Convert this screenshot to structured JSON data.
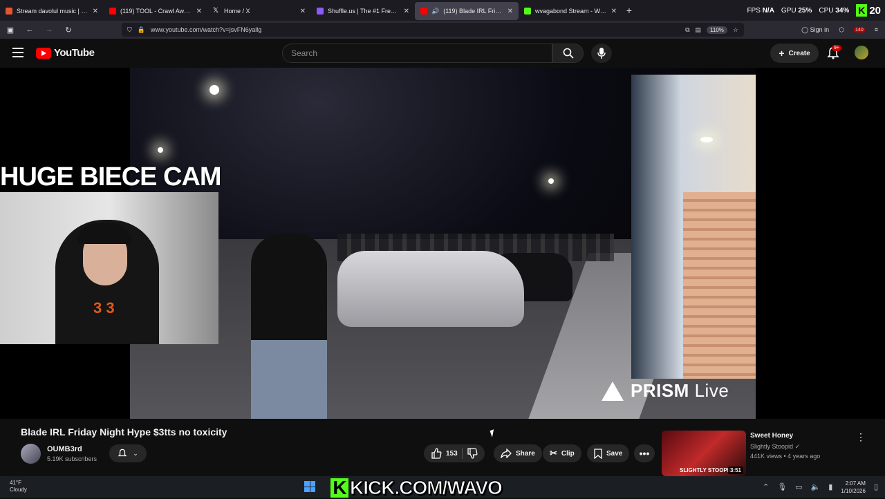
{
  "browser": {
    "tabs": [
      {
        "title": "Stream davolul music | Listen to",
        "color": "#e8542f"
      },
      {
        "title": "(119) TOOL - Crawl Away (Audio",
        "color": "#ff0000"
      },
      {
        "title": "Home / X",
        "color": "#ffffff"
      },
      {
        "title": "Shuffle.us | The #1 Free to Play",
        "color": "#8a5cf6"
      },
      {
        "title": "(119) Blade IRL Friday Night",
        "color": "#ff0000"
      },
      {
        "title": "wvagabond Stream - Watch Live",
        "color": "#53fc18"
      }
    ],
    "stats": {
      "fps_label": "FPS",
      "fps_value": "N/A",
      "gpu_label": "GPU",
      "gpu_value": "25%",
      "cpu_label": "CPU",
      "cpu_value": "34%",
      "kick_count": "20"
    },
    "url": "www.youtube.com/watch?v=jsvFN6yallg",
    "zoom": "110%",
    "sign_in": "Sign in",
    "ext_badge": "140"
  },
  "youtube": {
    "logo_text": "YouTube",
    "search_placeholder": "Search",
    "create_label": "Create",
    "notif_count": "9+"
  },
  "video": {
    "overlay_label": "HUGE BIECE CAM",
    "watermark": "PRISM",
    "watermark_light": "Live",
    "webcam_logo": "3 3"
  },
  "details": {
    "title": "Blade IRL Friday Night Hype $3tts no toxicity",
    "channel": "OUMB3rd",
    "subscribers": "5.19K subscribers",
    "likes": "153",
    "share": "Share",
    "clip": "Clip",
    "save": "Save"
  },
  "sidebar_video": {
    "title": "Sweet Honey",
    "channel": "Slightly Stoopid",
    "meta": "441K views • 4 years ago",
    "duration": "3:51",
    "thumb_text": "SLIGHTLY STOOPID"
  },
  "taskbar": {
    "temp": "41°F",
    "weather": "Cloudy",
    "banner": "KICK.COM/WAVO",
    "banner_k": "K",
    "time": "2:07 AM",
    "date": "1/10/2026"
  }
}
